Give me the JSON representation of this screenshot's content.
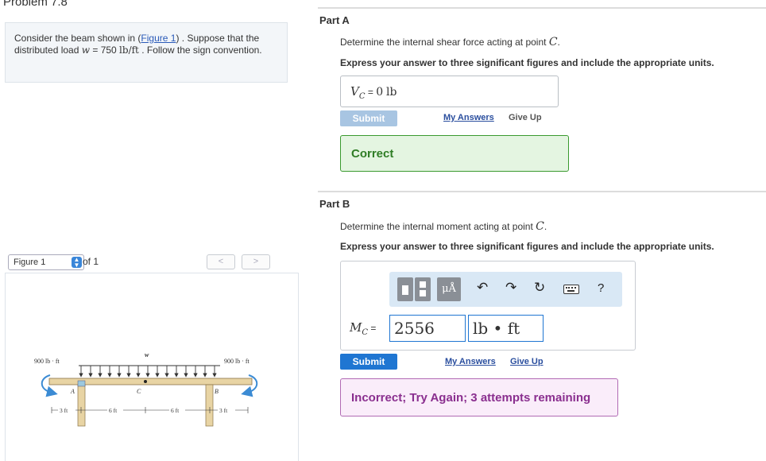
{
  "problem": {
    "title": "Problem 7.8",
    "text_before_link": "Consider the beam shown in (",
    "figure_link": "Figure 1",
    "text_after_link": ") . Suppose that the distributed load",
    "load_symbol": "w",
    "load_equals": " = 750 ",
    "load_units": "lb/ft",
    "text_end": " . Follow the sign convention."
  },
  "figure": {
    "select_label": "Figure 1",
    "of_text": "of 1",
    "prev_label": "<",
    "next_label": ">",
    "left_moment": "900 lb · ft",
    "right_moment": "900 lb · ft",
    "load_label": "w",
    "point_a": "A",
    "point_b": "B",
    "point_c": "C",
    "dim1": "3 ft",
    "dim2": "6 ft",
    "dim3": "6 ft",
    "dim4": "3 ft"
  },
  "part_a": {
    "label": "Part A",
    "question_prefix": "Determine the internal shear force acting at point ",
    "point": "C",
    "question_suffix": ".",
    "instruction": "Express your answer to three significant figures and include the appropriate units.",
    "var_symbol": "V",
    "var_sub": "C",
    "equals": " = ",
    "answer_value": "0",
    "answer_units": "lb",
    "submit_label": "Submit",
    "my_answers": "My Answers",
    "give_up": "Give Up",
    "feedback": "Correct"
  },
  "part_b": {
    "label": "Part B",
    "question_prefix": "Determine the internal moment acting at point ",
    "point": "C",
    "question_suffix": ".",
    "instruction": "Express your answer to three significant figures and include the appropriate units.",
    "var_symbol": "M",
    "var_sub": "C",
    "equals": " = ",
    "value": "2556",
    "units": "lb • ft",
    "toolbar_units_label": "μÅ",
    "toolbar_help": "?",
    "submit_label": "Submit",
    "my_answers": "My Answers",
    "give_up": "Give Up",
    "feedback": "Incorrect; Try Again; 3 attempts remaining"
  },
  "colors": {
    "submit_active": "#1f76d2",
    "submit_disabled": "#a8c5e2",
    "correct_bg": "#e4f5e1",
    "correct_border": "#3a9a2f",
    "incorrect_bg": "#faedfa",
    "incorrect_border": "#b16ab4",
    "toolbar_bg": "#d9e8f5"
  },
  "icons": [
    "template-icon",
    "units-icon",
    "undo-icon",
    "redo-icon",
    "reset-icon",
    "keyboard-icon",
    "help-icon"
  ]
}
